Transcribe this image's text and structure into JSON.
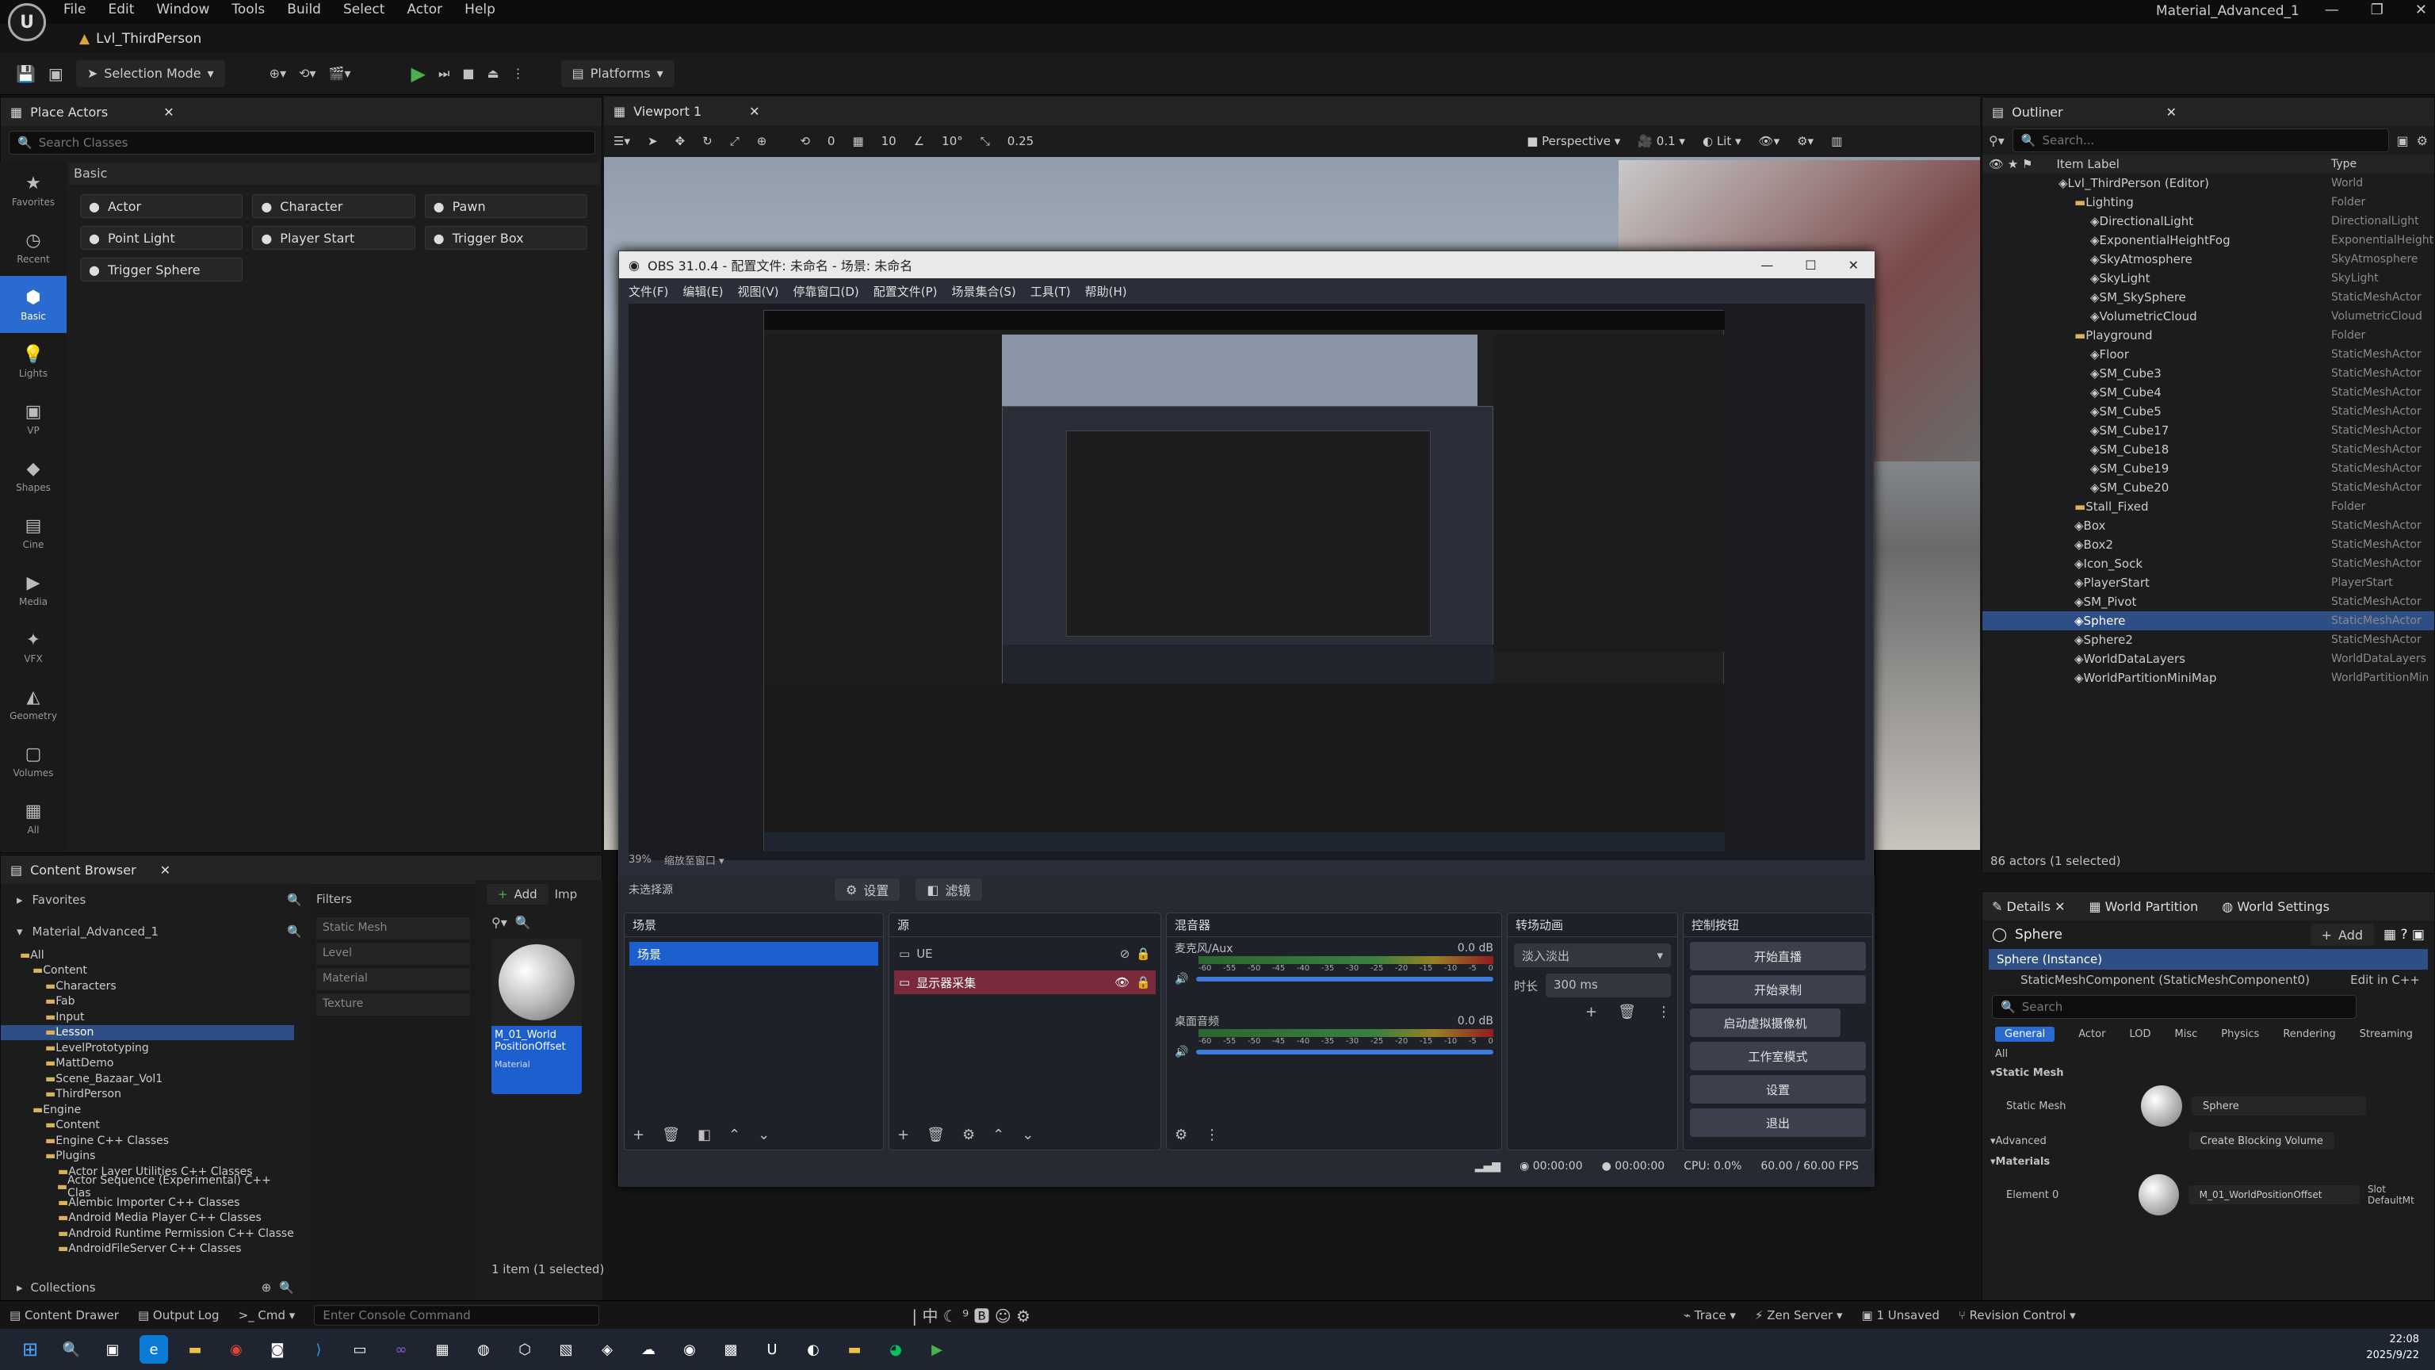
{
  "app": {
    "level_tab": "Lvl_ThirdPerson",
    "window_title": "Material_Advanced_1"
  },
  "menu": [
    "File",
    "Edit",
    "Window",
    "Tools",
    "Build",
    "Select",
    "Actor",
    "Help"
  ],
  "toolbar": {
    "mode": "Selection Mode",
    "platforms": "Platforms"
  },
  "place_actors": {
    "tab": "Place Actors",
    "search_placeholder": "Search Classes",
    "section": "Basic",
    "categories": [
      {
        "name": "Favorites",
        "icon": "star-icon"
      },
      {
        "name": "Recent",
        "icon": "clock-icon"
      },
      {
        "name": "Basic",
        "icon": "cube-icon"
      },
      {
        "name": "Lights",
        "icon": "bulb-icon"
      },
      {
        "name": "VP",
        "icon": "camera-icon"
      },
      {
        "name": "Shapes",
        "icon": "shapes-icon"
      },
      {
        "name": "Cine",
        "icon": "film-icon"
      },
      {
        "name": "Media",
        "icon": "media-icon"
      },
      {
        "name": "VFX",
        "icon": "vfx-icon"
      },
      {
        "name": "Geometry",
        "icon": "geometry-icon"
      },
      {
        "name": "Volumes",
        "icon": "volume-icon"
      },
      {
        "name": "All",
        "icon": "all-icon"
      }
    ],
    "actors": [
      "Actor",
      "Character",
      "Pawn",
      "Point Light",
      "Player Start",
      "Trigger Box",
      "Trigger Sphere"
    ]
  },
  "viewport": {
    "tab": "Viewport 1",
    "perspective": "Perspective",
    "lit": "Lit",
    "grid": "10",
    "angle": "10°",
    "scale": "0.25",
    "cam_speed": "0.1",
    "snap0": "0"
  },
  "obs": {
    "title": "OBS 31.0.4 - 配置文件: 未命名 - 场景: 未命名",
    "menu": [
      "文件(F)",
      "编辑(E)",
      "视图(V)",
      "停靠窗口(D)",
      "配置文件(P)",
      "场景集合(S)",
      "工具(T)",
      "帮助(H)"
    ],
    "zoom": "39%",
    "zoom_mode": "缩放至窗口",
    "no_source": "未选择源",
    "props": "设置",
    "filters": "滤镜",
    "scenes_title": "场景",
    "scenes": [
      "场景"
    ],
    "sources_title": "源",
    "sources": [
      "UE",
      "显示器采集"
    ],
    "mixer_title": "混音器",
    "mixer": [
      {
        "name": "麦克风/Aux",
        "db": "0.0 dB"
      },
      {
        "name": "桌面音频",
        "db": "0.0 dB"
      }
    ],
    "meter_ticks": [
      "-60",
      "-55",
      "-50",
      "-45",
      "-40",
      "-35",
      "-30",
      "-25",
      "-20",
      "-15",
      "-10",
      "-5",
      "0"
    ],
    "transition_title": "转场动画",
    "transition": "淡入淡出",
    "duration_label": "时长",
    "duration": "300 ms",
    "controls_title": "控制按钮",
    "controls": [
      "开始直播",
      "开始录制",
      "启动虚拟摄像机",
      "工作室模式",
      "设置",
      "退出"
    ],
    "status": {
      "stream_time": "00:00:00",
      "rec_time": "00:00:00",
      "cpu": "CPU: 0.0%",
      "fps": "60.00 / 60.00 FPS"
    }
  },
  "outliner": {
    "tab": "Outliner",
    "search_placeholder": "Search...",
    "col_label": "Item Label",
    "col_type": "Type",
    "count": "86 actors (1 selected)",
    "items": [
      {
        "l": "Lvl_ThirdPerson (Editor)",
        "t": "World",
        "d": 0,
        "f": false
      },
      {
        "l": "Lighting",
        "t": "Folder",
        "d": 1,
        "f": true
      },
      {
        "l": "DirectionalLight",
        "t": "DirectionalLight",
        "d": 2,
        "f": false
      },
      {
        "l": "ExponentialHeightFog",
        "t": "ExponentialHeight",
        "d": 2,
        "f": false
      },
      {
        "l": "SkyAtmosphere",
        "t": "SkyAtmosphere",
        "d": 2,
        "f": false
      },
      {
        "l": "SkyLight",
        "t": "SkyLight",
        "d": 2,
        "f": false
      },
      {
        "l": "SM_SkySphere",
        "t": "StaticMeshActor",
        "d": 2,
        "f": false
      },
      {
        "l": "VolumetricCloud",
        "t": "VolumetricCloud",
        "d": 2,
        "f": false
      },
      {
        "l": "Playground",
        "t": "Folder",
        "d": 1,
        "f": true
      },
      {
        "l": "Floor",
        "t": "StaticMeshActor",
        "d": 2,
        "f": false
      },
      {
        "l": "SM_Cube3",
        "t": "StaticMeshActor",
        "d": 2,
        "f": false
      },
      {
        "l": "SM_Cube4",
        "t": "StaticMeshActor",
        "d": 2,
        "f": false
      },
      {
        "l": "SM_Cube5",
        "t": "StaticMeshActor",
        "d": 2,
        "f": false
      },
      {
        "l": "SM_Cube17",
        "t": "StaticMeshActor",
        "d": 2,
        "f": false
      },
      {
        "l": "SM_Cube18",
        "t": "StaticMeshActor",
        "d": 2,
        "f": false
      },
      {
        "l": "SM_Cube19",
        "t": "StaticMeshActor",
        "d": 2,
        "f": false
      },
      {
        "l": "SM_Cube20",
        "t": "StaticMeshActor",
        "d": 2,
        "f": false
      },
      {
        "l": "Stall_Fixed",
        "t": "Folder",
        "d": 1,
        "f": true
      },
      {
        "l": "Box",
        "t": "StaticMeshActor",
        "d": 1,
        "f": false
      },
      {
        "l": "Box2",
        "t": "StaticMeshActor",
        "d": 1,
        "f": false
      },
      {
        "l": "Icon_Sock",
        "t": "StaticMeshActor",
        "d": 1,
        "f": false
      },
      {
        "l": "PlayerStart",
        "t": "PlayerStart",
        "d": 1,
        "f": false
      },
      {
        "l": "SM_Pivot",
        "t": "StaticMeshActor",
        "d": 1,
        "f": false
      },
      {
        "l": "Sphere",
        "t": "StaticMeshActor",
        "d": 1,
        "f": false,
        "sel": true
      },
      {
        "l": "Sphere2",
        "t": "StaticMeshActor",
        "d": 1,
        "f": false
      },
      {
        "l": "WorldDataLayers",
        "t": "WorldDataLayers",
        "d": 1,
        "f": false
      },
      {
        "l": "WorldPartitionMiniMap",
        "t": "WorldPartitionMin",
        "d": 1,
        "f": false
      }
    ]
  },
  "details": {
    "tabs": [
      "Details",
      "World Partition",
      "World Settings"
    ],
    "actor": "Sphere",
    "add": "Add",
    "instance": "Sphere (Instance)",
    "component": "StaticMeshComponent (StaticMeshComponent0)",
    "edit_cpp": "Edit in C++",
    "search_placeholder": "Search",
    "filters": [
      "General",
      "Actor",
      "LOD",
      "Misc",
      "Physics",
      "Rendering",
      "Streaming",
      "All"
    ],
    "sec_static_mesh": "Static Mesh",
    "static_mesh_label": "Static Mesh",
    "static_mesh_value": "Sphere",
    "sec_advanced": "Advanced",
    "blocking": "Create Blocking Volume",
    "sec_materials": "Materials",
    "element0": "Element 0",
    "material_value": "M_01_WorldPositionOffset",
    "slot": "Slot",
    "slot_value": "DefaultMt"
  },
  "content_browser": {
    "tab": "Content Browser",
    "favorites": "Favorites",
    "root": "Material_Advanced_1",
    "filters": "Filters",
    "add": "Add",
    "import": "Imp",
    "tree": [
      {
        "l": "All",
        "d": 0
      },
      {
        "l": "Content",
        "d": 1
      },
      {
        "l": "Characters",
        "d": 2
      },
      {
        "l": "Fab",
        "d": 2
      },
      {
        "l": "Input",
        "d": 2
      },
      {
        "l": "Lesson",
        "d": 2,
        "sel": true
      },
      {
        "l": "LevelPrototyping",
        "d": 2
      },
      {
        "l": "MattDemo",
        "d": 2
      },
      {
        "l": "Scene_Bazaar_Vol1",
        "d": 2
      },
      {
        "l": "ThirdPerson",
        "d": 2
      },
      {
        "l": "Engine",
        "d": 1
      },
      {
        "l": "Content",
        "d": 2
      },
      {
        "l": "Engine C++ Classes",
        "d": 2
      },
      {
        "l": "Plugins",
        "d": 2
      },
      {
        "l": "Actor Layer Utilities C++ Classes",
        "d": 3
      },
      {
        "l": "Actor Sequence (Experimental) C++ Clas",
        "d": 3
      },
      {
        "l": "Alembic Importer C++ Classes",
        "d": 3
      },
      {
        "l": "Android Media Player C++ Classes",
        "d": 3
      },
      {
        "l": "Android Runtime Permission C++ Classe",
        "d": 3
      },
      {
        "l": "AndroidFileServer C++ Classes",
        "d": 3
      }
    ],
    "filter_items": [
      "Static Mesh",
      "Level",
      "Material",
      "Texture"
    ],
    "asset": {
      "name": "M_01_World PositionOffset",
      "type": "Material"
    },
    "status": "1 item (1 selected)",
    "collections": "Collections"
  },
  "bottom": {
    "drawer": "Content Drawer",
    "output": "Output Log",
    "cmd": "Cmd",
    "console_placeholder": "Enter Console Command",
    "trace": "Trace",
    "zen": "Zen Server",
    "unsaved": "1 Unsaved",
    "revision": "Revision Control"
  },
  "taskbar": {
    "time": "22:08",
    "date": "2025/9/22",
    "ime": "中"
  },
  "colors": {
    "accent": "#2a6bd1",
    "obs_bg": "#2b2e38",
    "record": "#c62828"
  }
}
